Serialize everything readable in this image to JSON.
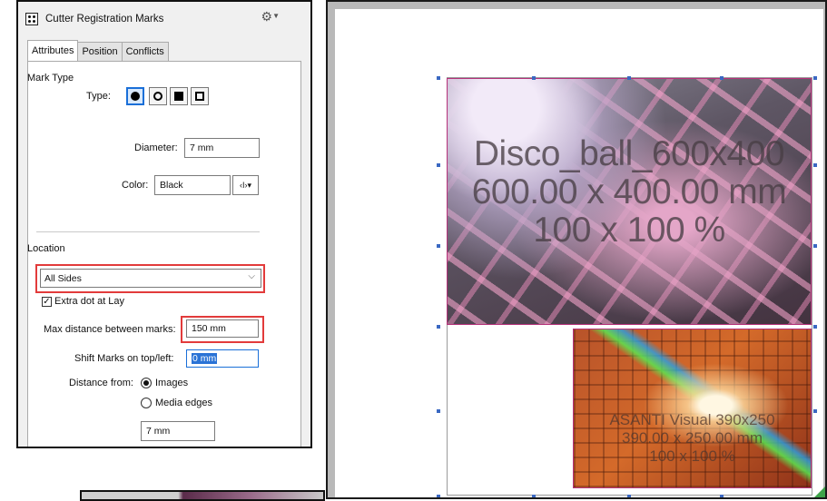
{
  "panel": {
    "title": "Cutter Registration Marks",
    "tabs": [
      {
        "label": "Attributes",
        "active": true
      },
      {
        "label": "Position",
        "active": false
      },
      {
        "label": "Conflicts",
        "active": false
      }
    ],
    "mark_type": {
      "section_label": "Mark Type",
      "type_label": "Type:",
      "shapes": [
        "filled-circle",
        "outline-circle",
        "filled-square",
        "outline-square"
      ],
      "selected_shape": "filled-circle"
    },
    "diameter": {
      "label": "Diameter:",
      "value": "7 mm"
    },
    "color": {
      "label": "Color:",
      "value": "Black",
      "picker_icon": "‹I›▾"
    },
    "location": {
      "section_label": "Location",
      "selected": "All Sides",
      "extra_dot_label": "Extra dot at Lay",
      "extra_dot_checked": true,
      "max_distance_label": "Max distance between marks:",
      "max_distance_value": "150 mm",
      "shift_label": "Shift Marks on top/left:",
      "shift_value": "0 mm",
      "distance_from_label": "Distance from:",
      "distance_options": [
        {
          "label": "Images",
          "selected": true
        },
        {
          "label": "Media edges",
          "selected": false
        }
      ],
      "distance_value": "7 mm"
    }
  },
  "canvas": {
    "images": [
      {
        "line1": "Disco_ball_600x400",
        "line2": "600.00 x 400.00 mm",
        "line3": "100 x 100 %"
      },
      {
        "line1": "ASANTI Visual 390x250",
        "line2": "390.00 x 250.00 mm",
        "line3": "100 x 100 %"
      }
    ]
  },
  "colors": {
    "highlight": "#e23b3b",
    "selection_blue": "#1a6fd8",
    "image_border": "#b5317a",
    "handle": "#3a68c2"
  }
}
